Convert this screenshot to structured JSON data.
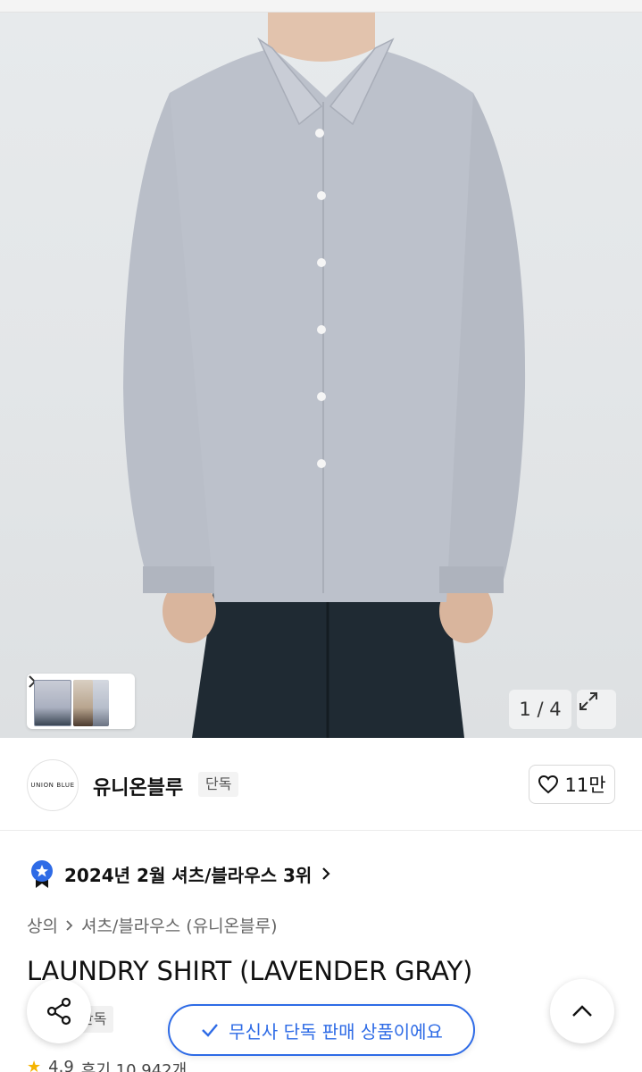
{
  "gallery": {
    "counter": "1 / 4",
    "thumbnail_count": 3
  },
  "brand": {
    "logo_text": "UNION BLUE",
    "name": "유니온블루",
    "badge": "단독",
    "likes": "11만"
  },
  "ranking": {
    "text": "2024년 2월 셔츠/블라우스 3위"
  },
  "breadcrumb": {
    "items": [
      "상의",
      "셔츠/블라우스 (유니온블루)"
    ]
  },
  "product": {
    "title": "LAUNDRY SHIRT (LAVENDER GRAY)",
    "badge": "단독",
    "rating": "4.9",
    "reviews": "후기 10,942개"
  },
  "floating": {
    "exclusive_text": "무신사 단독 판매 상품이에요"
  },
  "colors": {
    "accent_blue": "#2e6be6",
    "shirt": "#b7bcc6",
    "pants": "#1f2a33"
  }
}
